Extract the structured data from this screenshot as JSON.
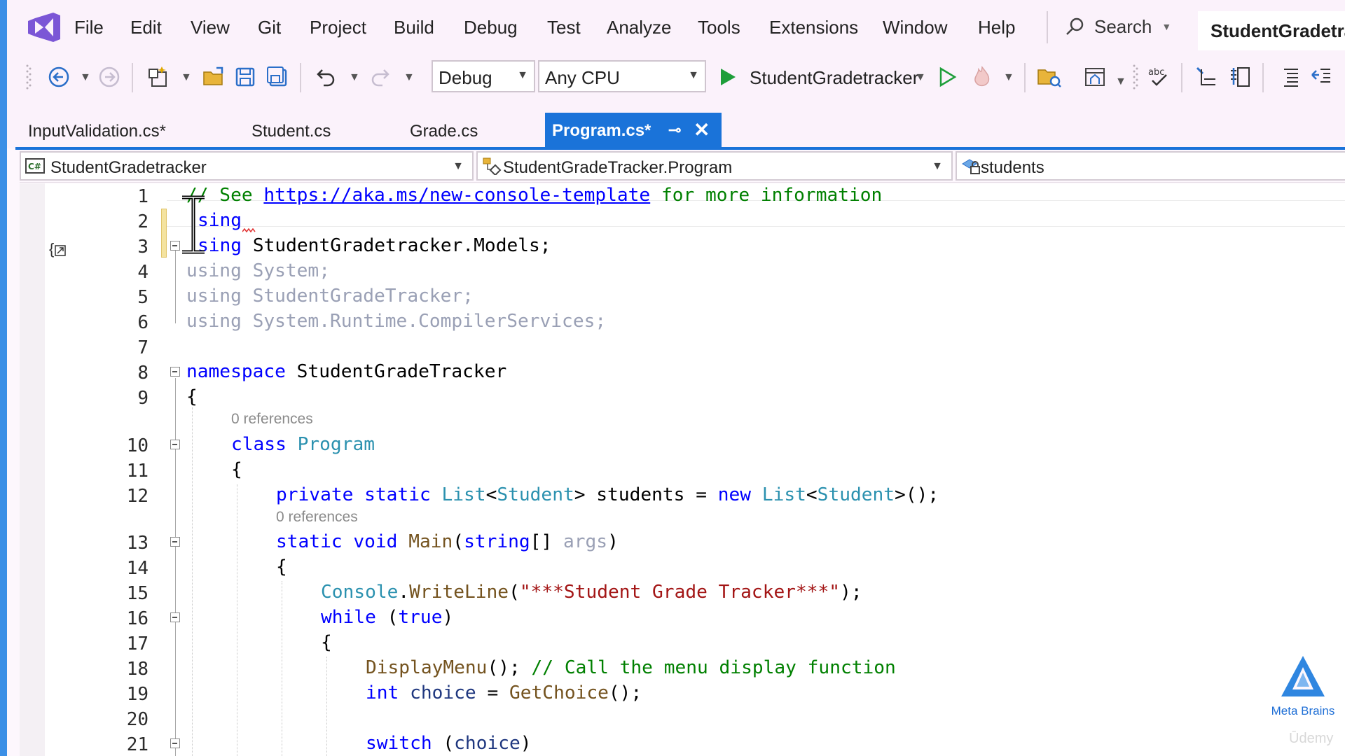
{
  "menu": {
    "items": [
      "File",
      "Edit",
      "View",
      "Git",
      "Project",
      "Build",
      "Debug",
      "Test",
      "Analyze",
      "Tools",
      "Extensions",
      "Window",
      "Help"
    ],
    "search_label": "Search",
    "solution_title": "StudentGradetracker"
  },
  "toolbar": {
    "config": "Debug",
    "platform": "Any CPU",
    "run_target": "StudentGradetracker"
  },
  "tabs": [
    {
      "label": "InputValidation.cs*"
    },
    {
      "label": "Student.cs"
    },
    {
      "label": "Grade.cs"
    },
    {
      "label": "Program.cs*",
      "active": true
    }
  ],
  "navbar": {
    "project": "StudentGradetracker",
    "type": "StudentGradeTracker.Program",
    "member": "students"
  },
  "editor": {
    "line_numbers": [
      "1",
      "2",
      "3",
      "4",
      "5",
      "6",
      "7",
      "8",
      "9",
      "10",
      "11",
      "12",
      "13",
      "14",
      "15",
      "16",
      "17",
      "18",
      "19",
      "20",
      "21"
    ],
    "current_line": "2",
    "codelens": [
      "0 references",
      "0 references"
    ],
    "code": {
      "l1_comment": "// See ",
      "l1_url": "https://aka.ms/new-console-template",
      "l1_rest": " for more information",
      "l2_kw": "sing",
      "l3_kw": "sing",
      "l3_rest": " StudentGradetracker.Models;",
      "l4": "using System;",
      "l5": "using StudentGradeTracker;",
      "l6": "using System.Runtime.CompilerServices;",
      "l8_kw": "namespace",
      "l8_name": " StudentGradeTracker",
      "l9": "{",
      "l10_kw": "class",
      "l10_name": "Program",
      "l11": "{",
      "l12_kw1": "private static ",
      "l12_t1": "List",
      "l12_p1": "<",
      "l12_t2": "Student",
      "l12_p2": "> ",
      "l12_id": "students",
      "l12_p3": " = ",
      "l12_kw2": "new ",
      "l12_t3": "List",
      "l12_p4": "<",
      "l12_t4": "Student",
      "l12_p5": ">();",
      "l13_kw": "static void ",
      "l13_m": "Main",
      "l13_p1": "(",
      "l13_kw2": "string",
      "l13_p2": "[] ",
      "l13_arg": "args",
      "l13_p3": ")",
      "l14": "{",
      "l15_t": "Console",
      "l15_p1": ".",
      "l15_m": "WriteLine",
      "l15_p2": "(",
      "l15_s": "\"***Student Grade Tracker***\"",
      "l15_p3": ");",
      "l16_kw": "while",
      "l16_p1": " (",
      "l16_kw2": "true",
      "l16_p2": ")",
      "l17": "{",
      "l18_m": "DisplayMenu",
      "l18_p": "(); ",
      "l18_c": "// Call the menu display function",
      "l19_kw": "int ",
      "l19_id": "choice",
      "l19_p1": " = ",
      "l19_m": "GetChoice",
      "l19_p2": "();",
      "l21_kw": "switch",
      "l21_p1": " (",
      "l21_id": "choice",
      "l21_p2": ")"
    }
  },
  "watermark": {
    "brand": "Meta Brains",
    "udemy": "Ūdemy"
  },
  "colors": {
    "accent": "#1a73d9",
    "keyword": "#0000ff",
    "type": "#2b91af",
    "comment": "#008000",
    "string": "#a31515",
    "method": "#74531f",
    "run_green": "#1e9e3a"
  }
}
